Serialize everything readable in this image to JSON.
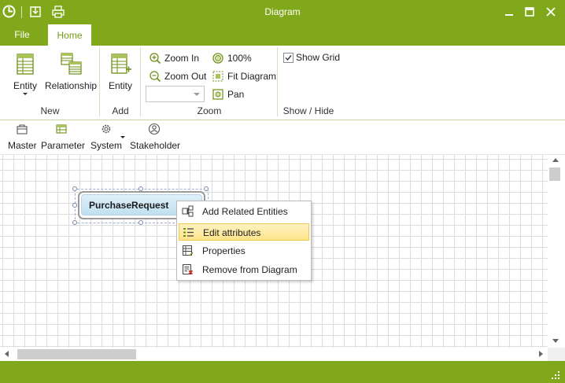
{
  "window": {
    "title": "Diagram"
  },
  "colors": {
    "accent": "#80a81a",
    "menu_highlight": "#fde48a",
    "entity_fill": "#c8e4f2"
  },
  "ribbon": {
    "tabs": [
      {
        "label": "File"
      },
      {
        "label": "Home"
      }
    ],
    "active_tab": "Home",
    "groups": {
      "new": {
        "label": "New",
        "entity_label": "Entity",
        "relationship_label": "Relationship"
      },
      "add": {
        "label": "Add",
        "entity_label": "Entity"
      },
      "zoom": {
        "label": "Zoom",
        "zoom_in_label": "Zoom In",
        "zoom_out_label": "Zoom Out",
        "hundred_label": "100%",
        "fit_label": "Fit Diagram",
        "pan_label": "Pan",
        "zoom_value": ""
      },
      "show_hide": {
        "label": "Show / Hide",
        "show_grid_label": "Show Grid",
        "show_grid_checked": true
      }
    }
  },
  "toolbox": {
    "items": [
      {
        "label": "Master"
      },
      {
        "label": "Parameter"
      },
      {
        "label": "System"
      },
      {
        "label": "Stakeholder"
      }
    ]
  },
  "diagram": {
    "entity": {
      "name": "PurchaseRequest"
    }
  },
  "context_menu": {
    "items": [
      {
        "label": "Add Related Entities"
      },
      {
        "label": "Edit attributes"
      },
      {
        "label": "Properties"
      },
      {
        "label": "Remove from Diagram"
      }
    ],
    "highlighted_index": 1
  }
}
